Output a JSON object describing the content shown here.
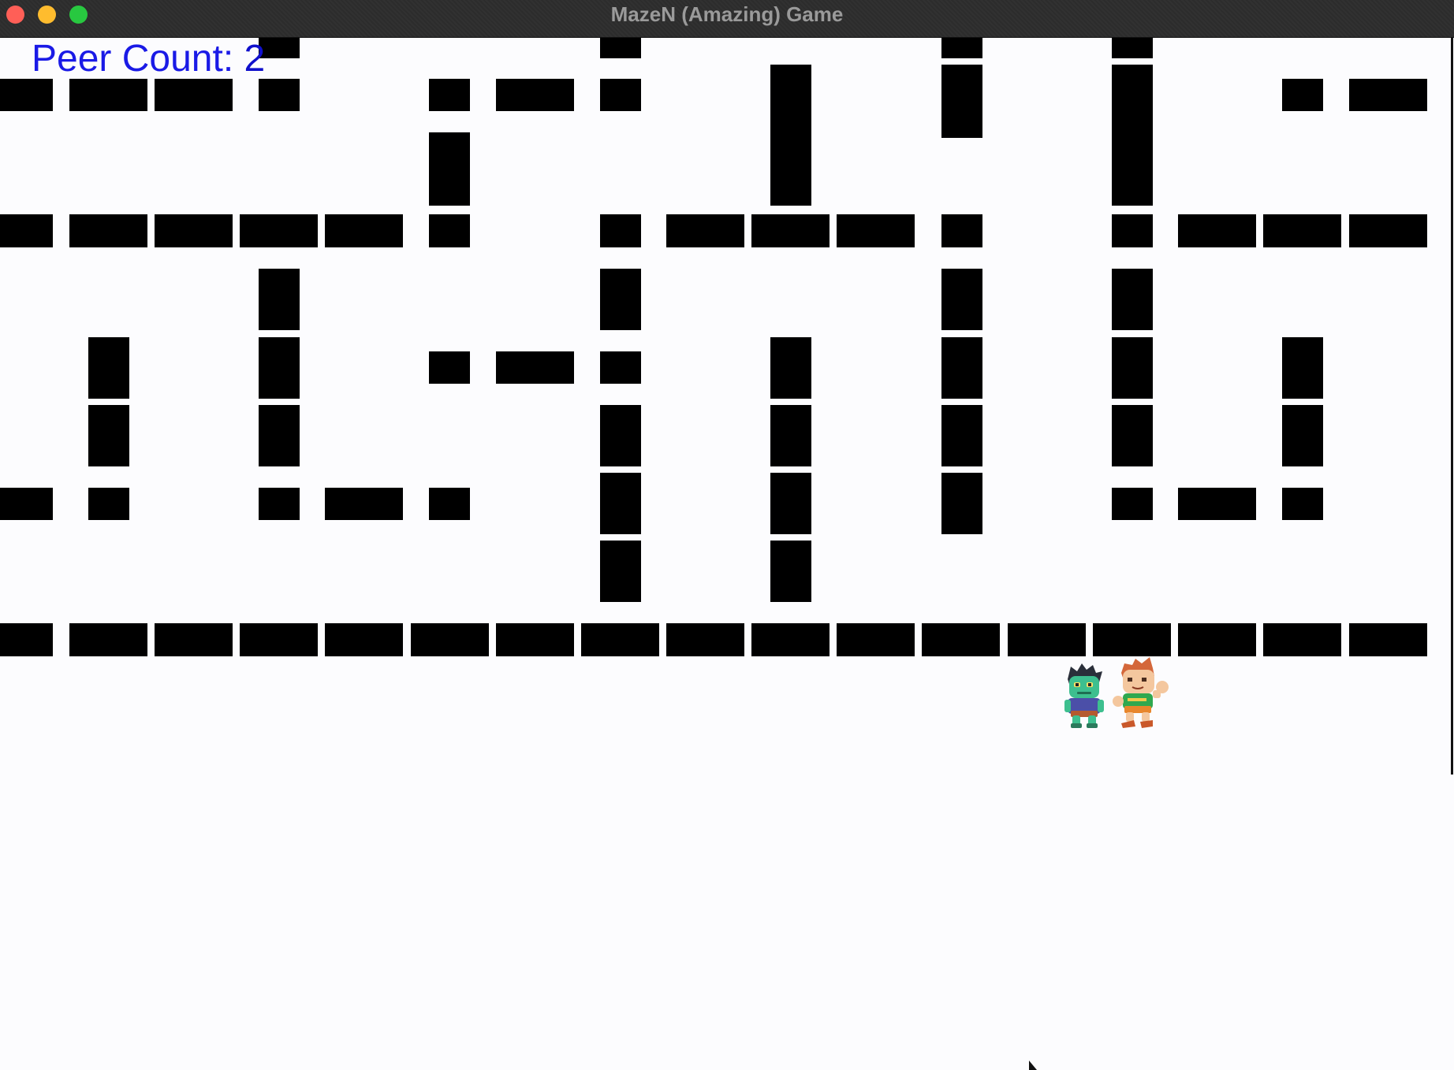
{
  "window": {
    "title": "MazeN (Amazing) Game"
  },
  "hud": {
    "label": "Peer Count: ",
    "peer_count": "2"
  },
  "players": [
    {
      "name": "zombie-player-sprite"
    },
    {
      "name": "hero-player-sprite"
    }
  ],
  "colors": {
    "wall": "#000000",
    "background": "#fcfcfe",
    "hud_text": "#1a1ae6"
  }
}
